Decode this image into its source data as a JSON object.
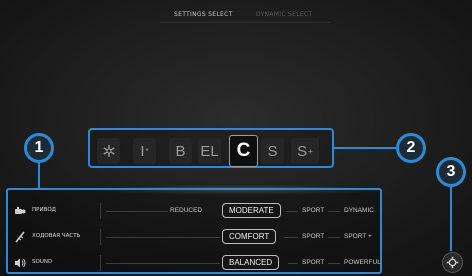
{
  "header": {
    "tabs": [
      {
        "label": "SETTINGS SELECT",
        "active": true
      },
      {
        "label": "DYNAMIC SELECT",
        "active": false
      }
    ]
  },
  "callouts": [
    "1",
    "2",
    "3"
  ],
  "modes": {
    "items": [
      {
        "icon": "snowflake-icon",
        "label": ""
      },
      {
        "label": "I",
        "sup": "*"
      },
      {
        "label": "B"
      },
      {
        "label": "EL"
      },
      {
        "label": "C",
        "selected": true
      },
      {
        "label": "S"
      },
      {
        "label": "S",
        "sup": "+"
      }
    ]
  },
  "settings": {
    "rows": [
      {
        "label": "ПРИВОД",
        "icon": "drivetrain-icon",
        "options": [
          "REDUCED",
          "MODERATE",
          "SPORT",
          "DYNAMIC"
        ],
        "selected": "MODERATE"
      },
      {
        "label": "ХОДОВАЯ ЧАСТЬ",
        "icon": "suspension-icon",
        "options": [
          "COMFORT",
          "SPORT",
          "SPORT +"
        ],
        "selected": "COMFORT"
      },
      {
        "label": "SOUND",
        "icon": "sound-icon",
        "options": [
          "BALANCED",
          "SPORT",
          "POWERFUL"
        ],
        "selected": "BALANCED"
      }
    ]
  },
  "colors": {
    "accent": "#2d8ad8"
  }
}
